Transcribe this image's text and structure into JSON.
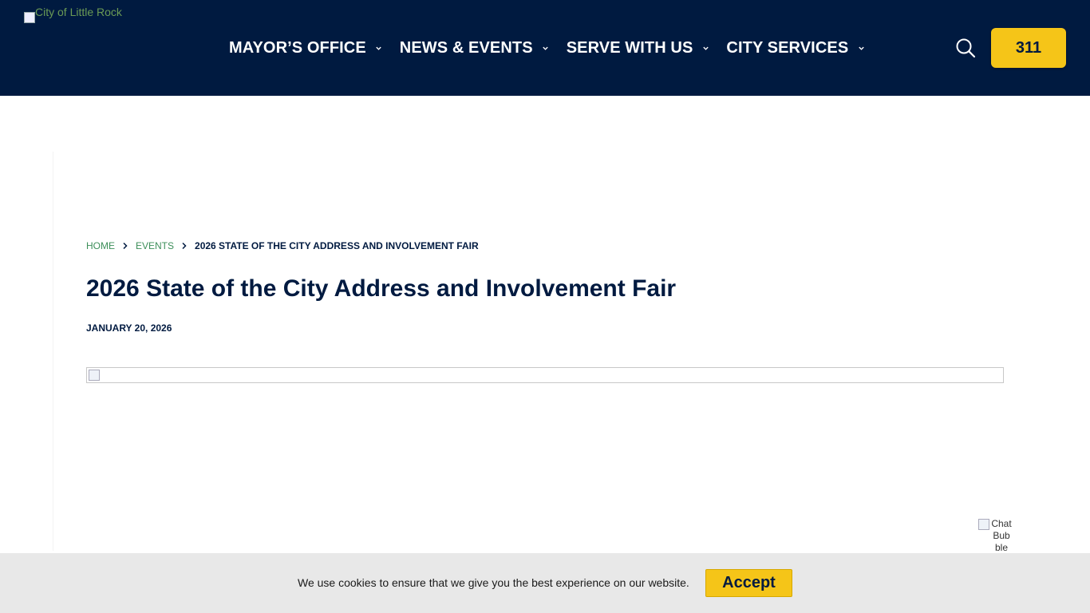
{
  "header": {
    "logo_alt": "City of Little Rock",
    "nav": [
      {
        "label": "MAYOR’S OFFICE"
      },
      {
        "label": "NEWS & EVENTS"
      },
      {
        "label": "SERVE WITH US"
      },
      {
        "label": "CITY SERVICES"
      }
    ],
    "button_311": "311",
    "colors": {
      "background": "#001a40",
      "accent": "#f5c518"
    }
  },
  "breadcrumb": {
    "home": "HOME",
    "events": "EVENTS",
    "current": "2026 STATE OF THE CITY ADDRESS AND INVOLVEMENT FAIR"
  },
  "article": {
    "title": "2026 State of the City Address and Involvement Fair",
    "date": "JANUARY 20, 2026"
  },
  "chat": {
    "alt_text": "Chat Bubble"
  },
  "cookie": {
    "message": "We use cookies to ensure that we give you the best experience on our website.",
    "accept_label": "Accept"
  }
}
